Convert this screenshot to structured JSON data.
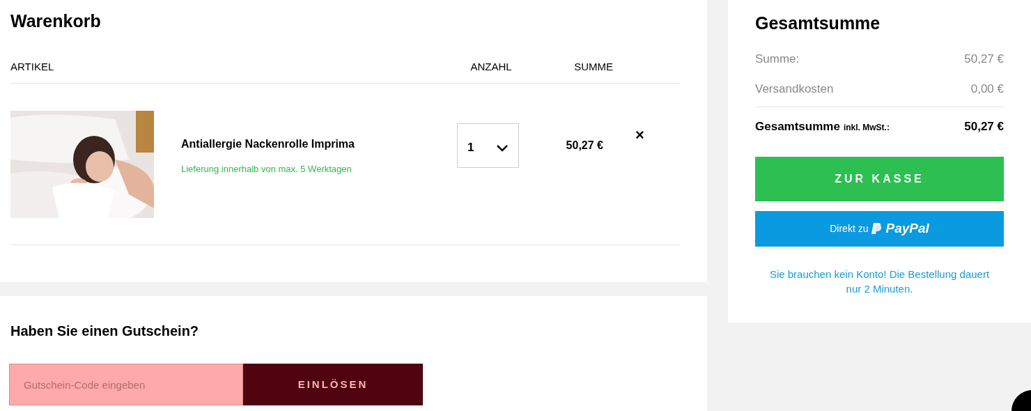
{
  "cart": {
    "title": "Warenkorb",
    "columns": [
      "ARTIKEL",
      "ANZAHL",
      "SUMME"
    ],
    "items": [
      {
        "kind": "picture",
        "name": "Antiallergie Nackenrolle Imprima",
        "delivery": "Lieferung innerhalb von max. 5 Werktagen",
        "quantity": "1",
        "price": "50,27 €",
        "remove": "×"
      }
    ]
  },
  "coupon": {
    "title": "Haben Sie einen Gutschein?",
    "placeholder": "Gutschein-Code eingeben",
    "button": "EINLÖSEN"
  },
  "summary": {
    "title": "Gesamtsumme",
    "rows": [
      {
        "label": "Summe:",
        "value": "50,27 €"
      },
      {
        "label": "Versandkosten",
        "value": "0,00 €"
      }
    ],
    "total": {
      "label": "Gesamtsumme",
      "note": "inkl. MwSt.:",
      "value": "50,27 €"
    },
    "checkout": "ZUR KASSE",
    "paypal": {
      "prefix": "Direkt zu",
      "brand": "PayPal"
    },
    "info": "Sie brauchen kein Konto! Die Bestellung dauert nur 2 Minuten."
  }
}
